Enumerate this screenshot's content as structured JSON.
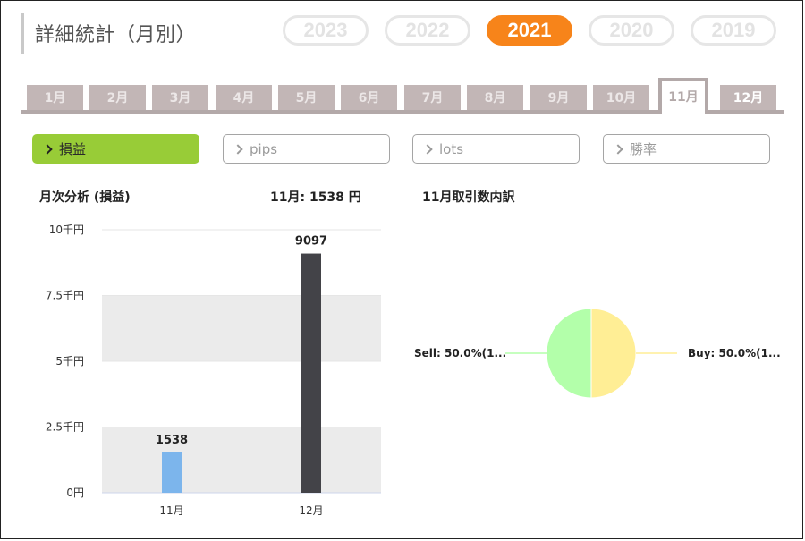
{
  "header": {
    "title": "詳細統計（月別）"
  },
  "years": [
    {
      "label": "2023",
      "active": false
    },
    {
      "label": "2022",
      "active": false
    },
    {
      "label": "2021",
      "active": true
    },
    {
      "label": "2020",
      "active": false
    },
    {
      "label": "2019",
      "active": false
    }
  ],
  "months": [
    {
      "label": "1月"
    },
    {
      "label": "2月"
    },
    {
      "label": "3月"
    },
    {
      "label": "4月"
    },
    {
      "label": "5月"
    },
    {
      "label": "6月"
    },
    {
      "label": "7月"
    },
    {
      "label": "8月"
    },
    {
      "label": "9月"
    },
    {
      "label": "10月"
    },
    {
      "label": "11月",
      "selected": true
    },
    {
      "label": "12月"
    }
  ],
  "metrics": [
    {
      "label": "損益",
      "active": true
    },
    {
      "label": "pips",
      "active": false
    },
    {
      "label": "lots",
      "active": false
    },
    {
      "label": "勝率",
      "active": false
    }
  ],
  "monthly_analysis": {
    "title": "月次分析 (損益)",
    "summary": "11月:  1538 円"
  },
  "breakdown": {
    "title": "11月取引数内訳"
  },
  "colors": {
    "accent": "#f7841a",
    "active_metric": "#98cc37",
    "bar_selected": "#7cb5ec",
    "bar_other": "#434348",
    "pie_sell": "#b3ffaa",
    "pie_buy": "#ffee95"
  },
  "chart_data": [
    {
      "type": "bar",
      "title": "",
      "categories": [
        "11月",
        "12月"
      ],
      "values": [
        1538,
        9097
      ],
      "data_labels": [
        "1538",
        "9097"
      ],
      "y_ticks": [
        "0円",
        "2.5千円",
        "5千円",
        "7.5千円",
        "10千円"
      ],
      "ylim": [
        0,
        10000
      ],
      "xlabel": "",
      "ylabel": ""
    },
    {
      "type": "pie",
      "labels": [
        "Sell: 50.0%(1...",
        "Buy: 50.0%(1..."
      ],
      "values": [
        50.0,
        50.0
      ]
    }
  ]
}
